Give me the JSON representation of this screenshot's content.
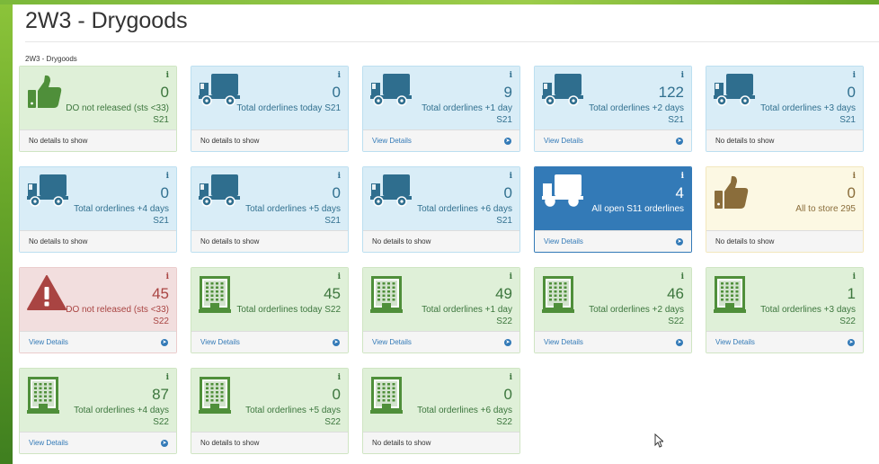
{
  "page": {
    "title": "2W3 - Drygoods",
    "breadcrumb": "2W3 - Drygoods"
  },
  "colors": {
    "green_bg": "#dff0d8",
    "green_text": "#3c763d",
    "green_icon": "#4f8f3a",
    "blue_bg": "#d9edf7",
    "blue_text": "#31708f",
    "blue_icon": "#2f6e8e",
    "primary_bg": "#337ab7",
    "yellow_bg": "#fcf8e3",
    "yellow_icon": "#8a6d3b",
    "red_bg": "#f2dede",
    "red_icon": "#a94442",
    "link": "#337ab7"
  },
  "tiles": [
    {
      "value": "0",
      "label": "DO not released (sts <33) S21",
      "footer": "No details to show",
      "has_details": false,
      "icon": "thumbs-up-icon",
      "variant": "green"
    },
    {
      "value": "0",
      "label": "Total orderlines today S21",
      "footer": "No details to show",
      "has_details": false,
      "icon": "truck-icon",
      "variant": "blue"
    },
    {
      "value": "9",
      "label": "Total orderlines +1 day S21",
      "footer": "View Details",
      "has_details": true,
      "icon": "truck-icon",
      "variant": "blue"
    },
    {
      "value": "122",
      "label": "Total orderlines +2 days S21",
      "footer": "View Details",
      "has_details": true,
      "icon": "truck-icon",
      "variant": "blue"
    },
    {
      "value": "0",
      "label": "Total orderlines +3 days S21",
      "footer": "No details to show",
      "has_details": false,
      "icon": "truck-icon",
      "variant": "blue"
    },
    {
      "value": "0",
      "label": "Total orderlines +4 days S21",
      "footer": "No details to show",
      "has_details": false,
      "icon": "truck-icon",
      "variant": "blue"
    },
    {
      "value": "0",
      "label": "Total orderlines +5 days S21",
      "footer": "No details to show",
      "has_details": false,
      "icon": "truck-icon",
      "variant": "blue"
    },
    {
      "value": "0",
      "label": "Total orderlines +6 days S21",
      "footer": "No details to show",
      "has_details": false,
      "icon": "truck-icon",
      "variant": "blue"
    },
    {
      "value": "4",
      "label": "All open S11 orderlines",
      "footer": "View Details",
      "has_details": true,
      "icon": "truck-icon",
      "variant": "primary"
    },
    {
      "value": "0",
      "label": "All to store 295",
      "footer": "No details to show",
      "has_details": false,
      "icon": "thumbs-up-icon",
      "variant": "yellow"
    },
    {
      "value": "45",
      "label": "DO not released (sts <33) S22",
      "footer": "View Details",
      "has_details": true,
      "icon": "warning-icon",
      "variant": "red"
    },
    {
      "value": "45",
      "label": "Total orderlines today S22",
      "footer": "View Details",
      "has_details": true,
      "icon": "building-icon",
      "variant": "green"
    },
    {
      "value": "49",
      "label": "Total orderlines +1 day S22",
      "footer": "View Details",
      "has_details": true,
      "icon": "building-icon",
      "variant": "green"
    },
    {
      "value": "46",
      "label": "Total orderlines +2 days S22",
      "footer": "View Details",
      "has_details": true,
      "icon": "building-icon",
      "variant": "green"
    },
    {
      "value": "1",
      "label": "Total orderlines +3 days S22",
      "footer": "View Details",
      "has_details": true,
      "icon": "building-icon",
      "variant": "green"
    },
    {
      "value": "87",
      "label": "Total orderlines +4 days S22",
      "footer": "View Details",
      "has_details": true,
      "icon": "building-icon",
      "variant": "green"
    },
    {
      "value": "0",
      "label": "Total orderlines +5 days S22",
      "footer": "No details to show",
      "has_details": false,
      "icon": "building-icon",
      "variant": "green"
    },
    {
      "value": "0",
      "label": "Total orderlines +6 days S22",
      "footer": "No details to show",
      "has_details": false,
      "icon": "building-icon",
      "variant": "green"
    }
  ]
}
